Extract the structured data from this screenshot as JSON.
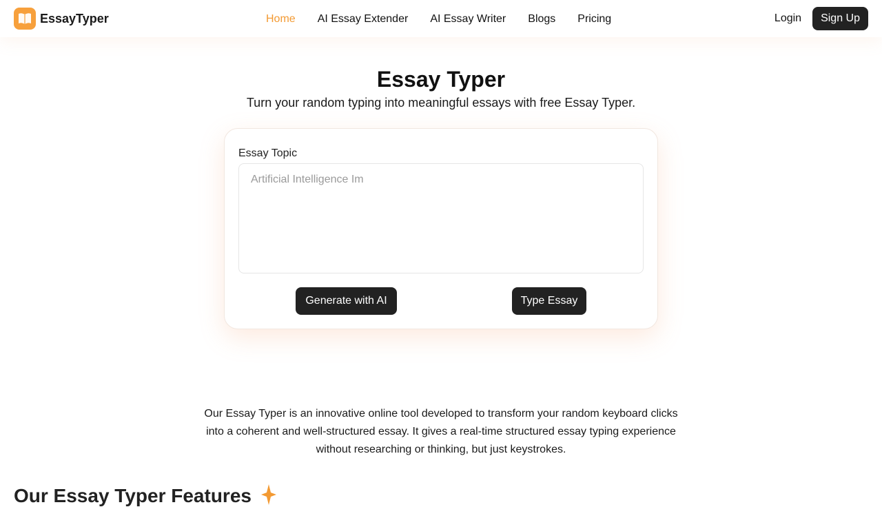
{
  "brand": {
    "name": "EssayTyper",
    "logo_icon": "book-icon",
    "accent": "#f7a03c"
  },
  "nav": {
    "items": [
      {
        "label": "Home",
        "active": true
      },
      {
        "label": "AI Essay Extender",
        "active": false
      },
      {
        "label": "AI Essay Writer",
        "active": false
      },
      {
        "label": "Blogs",
        "active": false
      },
      {
        "label": "Pricing",
        "active": false
      }
    ],
    "active_color": "#f39a33"
  },
  "auth": {
    "login_label": "Login",
    "signup_label": "Sign Up"
  },
  "hero": {
    "title": "Essay Typer",
    "subtitle": "Turn your random typing into meaningful essays with free Essay Typer."
  },
  "form": {
    "label": "Essay Topic",
    "placeholder": "Artificial Intelligence Im",
    "value": "",
    "generate_label": "Generate with AI",
    "type_label": "Type Essay"
  },
  "description": "Our Essay Typer is an innovative online tool developed to transform your random keyboard clicks into a coherent and well-structured essay. It gives a real-time structured essay typing experience without researching or thinking, but just keystrokes.",
  "features": {
    "title": "Our Essay Typer Features",
    "icon": "spark-icon"
  }
}
